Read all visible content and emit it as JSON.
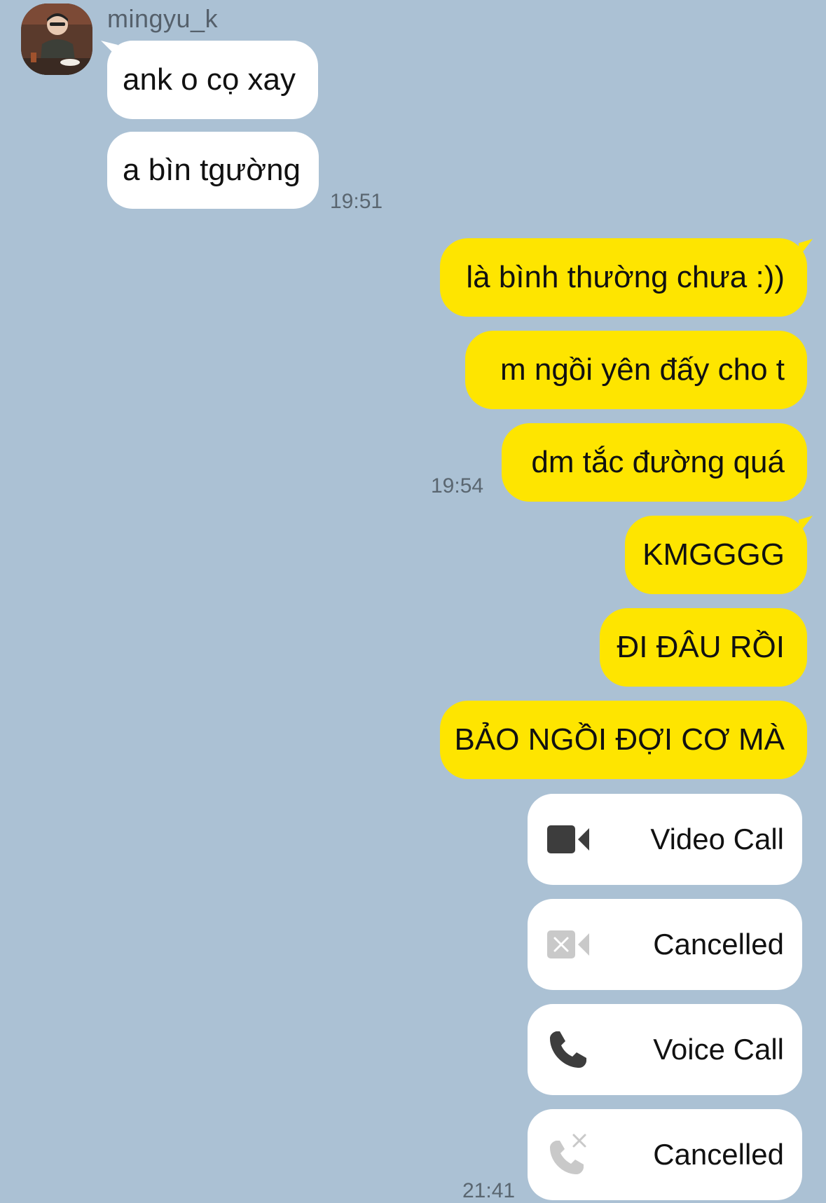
{
  "chat": {
    "sender_name": "mingyu_k",
    "incoming": [
      {
        "text": "ank o cọ xay"
      },
      {
        "text": "a bìn tgường"
      }
    ],
    "incoming_time": "19:51",
    "outgoing_group1": [
      {
        "text": "là bình thường chưa :))"
      },
      {
        "text": "m ngồi yên đấy cho t"
      },
      {
        "text": "dm tắc đường quá"
      }
    ],
    "outgoing_time1": "19:54",
    "outgoing_group2": [
      {
        "text": "KMGGGG"
      },
      {
        "text": "ĐI ĐÂU RỒI"
      },
      {
        "text": "BẢO NGỒI ĐỢI CƠ MÀ"
      }
    ],
    "calls": [
      {
        "label": "Video Call",
        "icon": "video-camera-icon"
      },
      {
        "label": "Cancelled",
        "icon": "video-cancelled-icon"
      },
      {
        "label": "Voice Call",
        "icon": "phone-icon"
      },
      {
        "label": "Cancelled",
        "icon": "phone-cancelled-icon"
      }
    ],
    "calls_time": "21:41"
  },
  "colors": {
    "background": "#abc1d4",
    "outgoing_bubble": "#fee500",
    "incoming_bubble": "#ffffff"
  }
}
